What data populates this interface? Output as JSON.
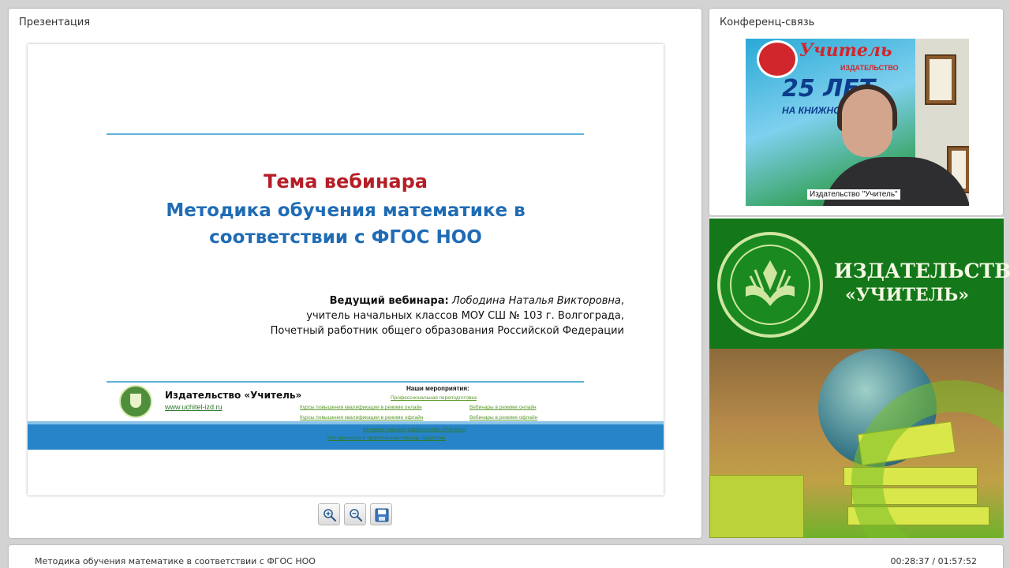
{
  "presentation_panel": {
    "title": "Презентация"
  },
  "conference_panel": {
    "title": "Конференц-связь"
  },
  "slide": {
    "topic_label": "Тема вебинара",
    "topic_line1": "Методика обучения математике в",
    "topic_line2": "соответствии с ФГОС НОО",
    "presenter_label": "Ведущий вебинара:",
    "presenter_name": "Лободина Наталья Викторовна",
    "presenter_line2": "учитель начальных классов МОУ СШ № 103 г. Волгограда,",
    "presenter_line3": "Почетный работник общего образования Российской Федерации",
    "publisher": "Издательство «Учитель»",
    "site": "www.uchitel-izd.ru",
    "events_heading": "Наши мероприятия:",
    "events": [
      "Профессиональная переподготовка",
      "Курсы повышения квалификации в режиме онлайн",
      "Вебинары в режиме онлайн",
      "Курсы повышения квалификации в режиме офлайн",
      "Вебинары в режиме офлайн",
      "Интернет-магазин издательства «Учитель»",
      "Методическая и практическая помощь педагогам"
    ]
  },
  "toolbar": {
    "zoom_in_icon": "zoom-in-icon",
    "zoom_out_icon": "zoom-out-icon",
    "save_icon": "floppy-disk-icon"
  },
  "video": {
    "caption": "Издательство \"Учитель\"",
    "banner_word1": "Учитель",
    "banner_word2": "ИЗДАТЕЛЬСТВО",
    "banner_word3": "25 ЛЕТ",
    "banner_word4": "НА КНИЖНОМ Р"
  },
  "ad": {
    "line1": "ИЗДАТЕЛЬСТВО",
    "line2": "«УЧИТЕЛЬ»"
  },
  "bottom_bar": {
    "title": "Методика обучения математике в соответствии с ФГОС НОО",
    "time": "00:28:37 / 01:57:52"
  },
  "colors": {
    "topic_red": "#b51e27",
    "topic_blue": "#1f6cb5",
    "band_blue": "#2784c9",
    "ad_green": "#14781b"
  }
}
